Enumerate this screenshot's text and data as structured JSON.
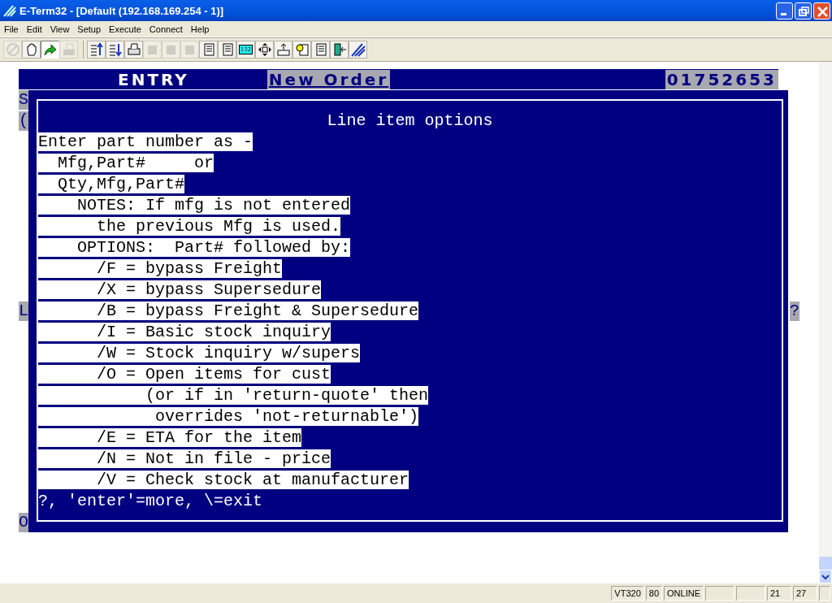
{
  "window": {
    "title": "E-Term32 - [Default (192.168.169.254 - 1)]"
  },
  "menu": [
    "File",
    "Edit",
    "View",
    "Setup",
    "Execute",
    "Connect",
    "Help"
  ],
  "toolbar": [
    {
      "kind": "stop",
      "disabled": true
    },
    {
      "kind": "hand",
      "disabled": false
    },
    {
      "kind": "arrow",
      "disabled": false
    },
    {
      "kind": "fax",
      "disabled": true
    },
    {
      "kind": "up",
      "disabled": false
    },
    {
      "kind": "down",
      "disabled": false
    },
    {
      "kind": "print",
      "disabled": false
    },
    {
      "kind": "copy",
      "disabled": true
    },
    {
      "kind": "paste",
      "disabled": true
    },
    {
      "kind": "erase",
      "disabled": true
    },
    {
      "kind": "doc",
      "disabled": false
    },
    {
      "kind": "doc2",
      "disabled": false
    },
    {
      "kind": "cols",
      "disabled": false
    },
    {
      "kind": "move",
      "disabled": false
    },
    {
      "kind": "keyboard",
      "disabled": false
    },
    {
      "kind": "help",
      "disabled": false
    },
    {
      "kind": "script",
      "disabled": false
    },
    {
      "kind": "exit",
      "disabled": false
    },
    {
      "kind": "logo",
      "disabled": false
    }
  ],
  "cols_label": "132",
  "terminal": {
    "header": {
      "title": "ENTRY",
      "mode": "New Order",
      "order_number": "01752653"
    },
    "background_rows": [
      {
        "left": "S"
      },
      {
        "left": "("
      },
      {
        "left": "L",
        "right": "?"
      },
      {
        "left": "O"
      }
    ],
    "popup": {
      "title": "Line item options",
      "lines": [
        {
          "text": "Enter part number as -",
          "highlight": true
        },
        {
          "text": "  Mfg,Part#     or",
          "highlight": true
        },
        {
          "text": "  Qty,Mfg,Part#",
          "highlight": true
        },
        {
          "text": "    NOTES: If mfg is not entered",
          "highlight": true
        },
        {
          "text": "      the previous Mfg is used.",
          "highlight": true
        },
        {
          "text": "    OPTIONS:  Part# followed by:",
          "highlight": true
        },
        {
          "text": "      /F = bypass Freight",
          "highlight": true
        },
        {
          "text": "      /X = bypass Supersedure",
          "highlight": true
        },
        {
          "text": "      /B = bypass Freight & Supersedure",
          "highlight": true
        },
        {
          "text": "      /I = Basic stock inquiry",
          "highlight": true
        },
        {
          "text": "      /W = Stock inquiry w/supers",
          "highlight": true
        },
        {
          "text": "      /O = Open items for cust",
          "highlight": true
        },
        {
          "text": "           (or if in 'return-quote' then",
          "highlight": true
        },
        {
          "text": "            overrides 'not-returnable')",
          "highlight": true
        },
        {
          "text": "      /E = ETA for the item",
          "highlight": true
        },
        {
          "text": "      /N = Not in file - price",
          "highlight": true
        },
        {
          "text": "      /V = Check stock at manufacturer",
          "highlight": true
        },
        {
          "text": "?, 'enter'=more, \\=exit",
          "highlight": false
        }
      ]
    }
  },
  "status_bar": [
    "VT320",
    "80",
    "ONLINE",
    "21",
    "27"
  ]
}
